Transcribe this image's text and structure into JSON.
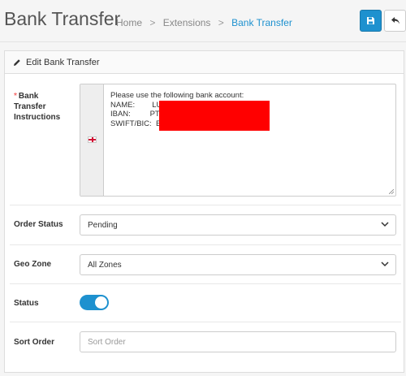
{
  "header": {
    "title": "Bank Transfer",
    "breadcrumb": [
      {
        "label": "Home"
      },
      {
        "label": "Extensions"
      },
      {
        "label": "Bank Transfer"
      }
    ],
    "save_icon": "floppy-disk-icon",
    "back_icon": "reply-arrow-icon"
  },
  "panel": {
    "heading": "Edit Bank Transfer",
    "heading_icon": "pencil-icon"
  },
  "form": {
    "instructions": {
      "required_mark": "*",
      "label_lines": [
        "Bank",
        "Transfer",
        "Instructions"
      ],
      "language_flag": "uk-flag-icon",
      "text": "Please use the following bank account:\nNAME:        LU\nIBAN:         PT\nSWIFT/BIC:  BE"
    },
    "order_status": {
      "label": "Order Status",
      "value": "Pending"
    },
    "geo_zone": {
      "label": "Geo Zone",
      "value": "All Zones"
    },
    "status": {
      "label": "Status",
      "enabled": true
    },
    "sort_order": {
      "label": "Sort Order",
      "value": "",
      "placeholder": "Sort Order"
    }
  },
  "colors": {
    "primary": "#1e91cf",
    "redaction": "#ff0000",
    "required": "#f56b6b"
  }
}
